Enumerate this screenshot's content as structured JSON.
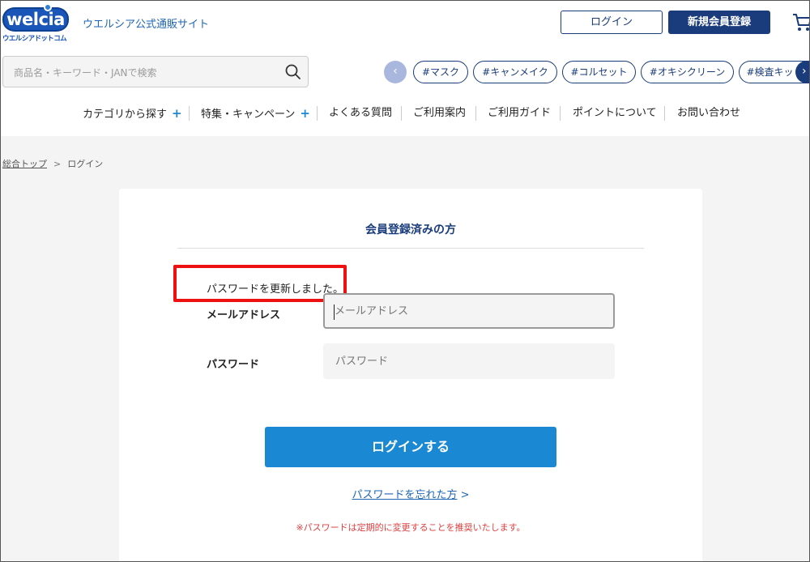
{
  "header": {
    "logo_main": "welcia",
    "logo_sub": "ウエルシアドットコム",
    "site_name": "ウエルシア公式通販サイト",
    "login_label": "ログイン",
    "register_label": "新規会員登録"
  },
  "search": {
    "placeholder": "商品名・キーワード・JANで検索"
  },
  "tags": {
    "prev": "‹",
    "next": "›",
    "items": [
      "#マスク",
      "#キャンメイク",
      "#コルセット",
      "#オキシクリーン",
      "#検査キット"
    ]
  },
  "nav": {
    "items": [
      "カテゴリから探す",
      "特集・キャンペーン",
      "よくある質問",
      "ご利用案内",
      "ご利用ガイド",
      "ポイントについて",
      "お問い合わせ"
    ],
    "plus": "+"
  },
  "breadcrumb": {
    "home": "総合トップ",
    "separator": ">",
    "current": "ログイン"
  },
  "login": {
    "title": "会員登録済みの方",
    "notice": "パスワードを更新しました。",
    "email_label": "メールアドレス",
    "email_placeholder": "メールアドレス",
    "password_label": "パスワード",
    "password_placeholder": "パスワード",
    "submit_label": "ログインする",
    "forgot_label": "パスワードを忘れた方",
    "forgot_arrow": ">",
    "warning": "※パスワードは定期的に変更することを推奨いたします。"
  },
  "colors": {
    "navy": "#1a3c7c",
    "accent_blue": "#1a88d2",
    "highlight_red": "#ee1111",
    "warning_red": "#e04040"
  }
}
